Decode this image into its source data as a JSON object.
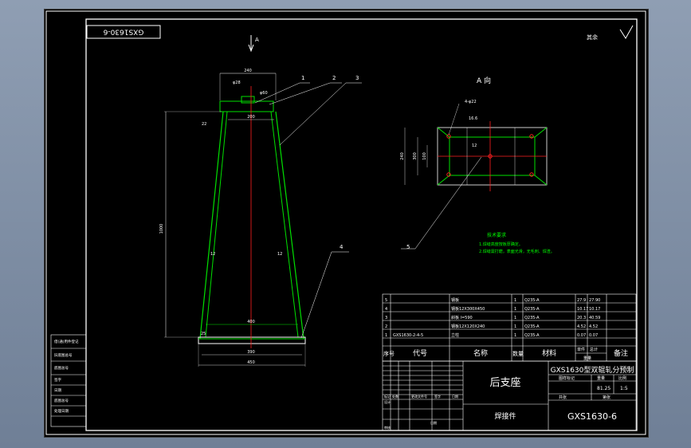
{
  "drawing": {
    "number_stamp": "GXS1630-6",
    "roughness_mark": "其余",
    "view_arrow_label": "A",
    "view_title": "A 向",
    "leaders": [
      "1",
      "2",
      "3",
      "4",
      "5"
    ],
    "dimensions": {
      "top_width": "240",
      "hole_dia": "φ28",
      "bore": "φ60",
      "plate_inner": "200",
      "plate_thk": "22",
      "height": "1000",
      "bottom_inner": "400",
      "bottom_width": "390",
      "base_width": "450",
      "base_thk": "25",
      "wall_l": "12",
      "wall_r": "12",
      "view_holes": "4-φ22",
      "view_hole_offset": "16.6",
      "view_height": "240",
      "view_inner": "300",
      "view_mid": "100",
      "view_small": "12"
    },
    "tech_notes": {
      "title": "技术要求",
      "lines": [
        "1.焊缝高度按板厚确定。",
        "2.焊缝需打磨，表面光滑，无毛刺、焊渣。"
      ]
    }
  },
  "parts_list": {
    "rows": [
      {
        "no": "5",
        "code": "",
        "name": "钢板",
        "qty": "1",
        "material": "Q235-A",
        "unit": "27.9",
        "total": "27.90"
      },
      {
        "no": "4",
        "code": "",
        "name": "钢板12X300X450",
        "qty": "1",
        "material": "Q235-A",
        "unit": "10.17",
        "total": "10.17"
      },
      {
        "no": "3",
        "code": "",
        "name": "斜板 l=590",
        "qty": "1",
        "material": "Q235-A",
        "unit": "20.3",
        "total": "40.59"
      },
      {
        "no": "2",
        "code": "",
        "name": "钢板12X120X240",
        "qty": "1",
        "material": "Q235-A",
        "unit": "4.52",
        "total": "4.52"
      },
      {
        "no": "1",
        "code": "GXS1630-2-4-5",
        "name": "立柱",
        "qty": "1",
        "material": "Q235-A",
        "unit": "0.07",
        "total": "0.07"
      }
    ],
    "headers": {
      "no": "序号",
      "code": "代号",
      "name": "名称",
      "qty": "数量",
      "material": "材料",
      "unit": "单件",
      "total": "总计",
      "weight": "重量",
      "remark": "备注"
    }
  },
  "title_block": {
    "part_name": "后支座",
    "part_type": "焊接件",
    "project": "GXS1630型双辊轧分预制",
    "drawing_no": "GXS1630-6",
    "weight": "81.25",
    "scale": "1:5",
    "col_labels": [
      "图样标记",
      "重量",
      "比例"
    ],
    "sheet_labels": [
      "共张",
      "第张"
    ],
    "mini_labels": [
      "标记",
      "处数",
      "更改文件号",
      "签字",
      "日期"
    ],
    "sign_labels": [
      "设计",
      "审核"
    ],
    "approve_label": "日期"
  },
  "side_block": {
    "labels": [
      "借(通)用件登记",
      "旧底图总号",
      "底图总号",
      "签字",
      "日期",
      "底图总号",
      "处理日期"
    ]
  }
}
